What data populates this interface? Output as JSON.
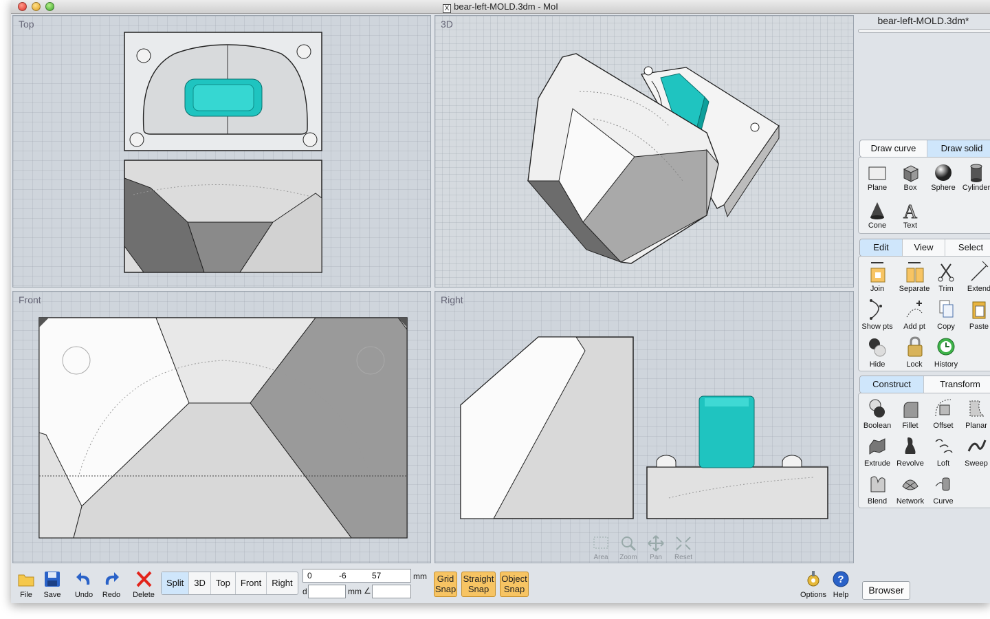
{
  "window": {
    "title": "bear-left-MOLD.3dm - MoI"
  },
  "viewports": {
    "top": "Top",
    "three_d": "3D",
    "front": "Front",
    "right": "Right"
  },
  "nav_tools": [
    "Area",
    "Zoom",
    "Pan",
    "Reset"
  ],
  "toolbar": {
    "file": "File",
    "save": "Save",
    "undo": "Undo",
    "redo": "Redo",
    "delete": "Delete"
  },
  "view_modes": {
    "split": "Split",
    "three_d": "3D",
    "top": "Top",
    "front": "Front",
    "right": "Right",
    "selected": "Split"
  },
  "coordinates": {
    "x": "0",
    "y": "-6",
    "z": "57",
    "unit": "mm",
    "distance_label": "d",
    "distance_value": "",
    "distance_unit": "mm",
    "angle_symbol": "∠",
    "angle_value": ""
  },
  "snaps": {
    "grid": [
      "Grid",
      "Snap"
    ],
    "straight": [
      "Straight",
      "Snap"
    ],
    "object": [
      "Object",
      "Snap"
    ]
  },
  "side_buttons": {
    "options": "Options",
    "help": "Help"
  },
  "panel": {
    "file_name": "bear-left-MOLD.3dm*",
    "draw_tabs": [
      "Draw curve",
      "Draw solid"
    ],
    "draw_selected": "Draw solid",
    "draw_items": [
      "Plane",
      "Box",
      "Sphere",
      "Cylinder",
      "Cone",
      "Text"
    ],
    "edit_tabs": [
      "Edit",
      "View",
      "Select"
    ],
    "edit_selected": "Edit",
    "edit_items": [
      "Join",
      "Separate",
      "Trim",
      "Extend",
      "Show pts",
      "Add pt",
      "Copy",
      "Paste",
      "Hide",
      "Lock",
      "History"
    ],
    "construct_tabs": [
      "Construct",
      "Transform"
    ],
    "construct_selected": "Construct",
    "construct_items": [
      "Boolean",
      "Fillet",
      "Offset",
      "Planar",
      "Extrude",
      "Revolve",
      "Loft",
      "Sweep",
      "Blend",
      "Network",
      "Curve"
    ],
    "browser": "Browser"
  },
  "colors": {
    "accent_cyan": "#1fc4c0",
    "tab_selected": "#cfe6fb",
    "snap_orange": "#f7c463",
    "viewport_bg": "#cfd5dc"
  }
}
